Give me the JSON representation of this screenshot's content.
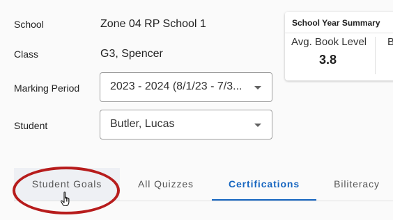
{
  "form": {
    "school_label": "School",
    "school_value": "Zone 04 RP School 1",
    "class_label": "Class",
    "class_value": "G3, Spencer",
    "marking_period_label": "Marking Period",
    "marking_period_value": "2023 - 2024 (8/1/23 - 7/3...",
    "student_label": "Student",
    "student_value": "Butler, Lucas"
  },
  "summary": {
    "title": "School Year Summary",
    "metric1_label": "Avg. Book Level",
    "metric1_value": "3.8",
    "metric2_label_partial": "B"
  },
  "tabs": [
    {
      "label": "Student Goals",
      "state": "hover"
    },
    {
      "label": "All Quizzes",
      "state": "normal"
    },
    {
      "label": "Certifications",
      "state": "active"
    },
    {
      "label": "Biliteracy",
      "state": "normal"
    }
  ],
  "colors": {
    "accent": "#1565c0",
    "annotation": "#b71c1c",
    "background": "#fafafa"
  },
  "icons": {
    "dropdown": "caret-down-icon",
    "cursor": "hand-pointer-icon"
  }
}
